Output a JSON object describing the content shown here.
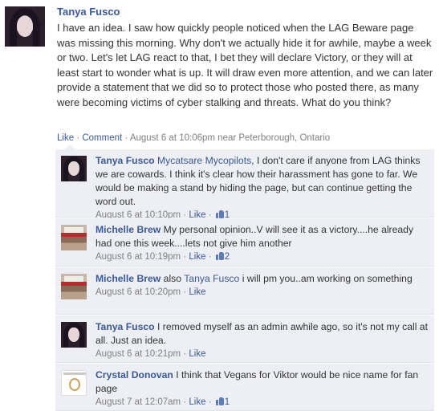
{
  "post": {
    "author": "Tanya Fusco",
    "text": "I have an idea. I saw how quickly people noticed when the LAG Beware page was missing this morning. Why don't we actually hide it for awhile, maybe a week or two. Let's let LAG react to that, I bet they will declare Victory, or they will at least start to wonder what is up. It will draw even more attention, and we can later provide a statement that we did so to protect those who posted there, as many were becoming victims of cyber stalking and threats. What do you think?",
    "like_label": "Like",
    "comment_label": "Comment",
    "separator": "·",
    "timestamp": "August 6 at 10:06pm near Peterborough, Ontario"
  },
  "comments": [
    {
      "author": "Tanya Fusco",
      "mention": "Mycatsare Mycopilots",
      "text": ", I don't care if anyone from LAG thinks we are cowards. I think it's clear how their harassment has gone to far. We would be making a stand by hiding the page, but can continue getting the word out.",
      "time": "August 6 at 10:10pm",
      "like_label": "Like",
      "likes": "1"
    },
    {
      "author": "Michelle Brew",
      "mention": "",
      "text": "My personal opinion..V will see it as a victory....he already had one this week....lets not give him another",
      "time": "August 6 at 10:19pm",
      "like_label": "Like",
      "likes": "2"
    },
    {
      "author": "Michelle Brew",
      "pre": "also",
      "mention": "Tanya Fusco",
      "text": "i will pm you..am working on something",
      "time": "August 6 at 10:20pm",
      "like_label": "Like",
      "likes": ""
    },
    {
      "author": "Tanya Fusco",
      "mention": "",
      "text": "I removed myself as an admin awhile ago, so it's not my call at all. Just an idea.",
      "time": "August 6 at 10:21pm",
      "like_label": "Like",
      "likes": ""
    },
    {
      "author": "Crystal Donovan",
      "mention": "",
      "text": "I think that Vegans for Viktor would be nice name for fan page",
      "time": "August 7 at 12:07am",
      "like_label": "Like",
      "likes": "1"
    }
  ],
  "colors": {
    "link": "#3b5998",
    "comment_bg": "#edeff4",
    "meta": "#808080"
  }
}
